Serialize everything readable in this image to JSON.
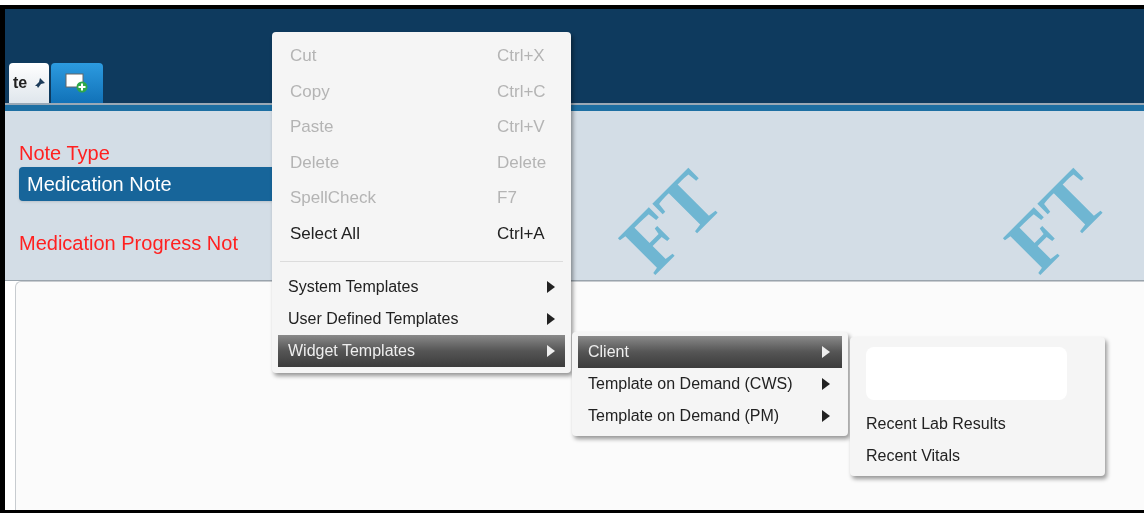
{
  "tabs": [
    {
      "label": "te",
      "kind": "note",
      "selected": true
    },
    {
      "kind": "new",
      "selected": false
    }
  ],
  "form": {
    "note_type_label": "Note Type",
    "note_type_value": "Medication Note",
    "progress_label": "Medication Progress Not"
  },
  "watermark": [
    "FT",
    "FT"
  ],
  "context_menu": {
    "items": [
      {
        "kind": "command",
        "label": "Cut",
        "shortcut": "Ctrl+X",
        "disabled": true
      },
      {
        "kind": "command",
        "label": "Copy",
        "shortcut": "Ctrl+C",
        "disabled": true
      },
      {
        "kind": "command",
        "label": "Paste",
        "shortcut": "Ctrl+V",
        "disabled": true
      },
      {
        "kind": "command",
        "label": "Delete",
        "shortcut": "Delete",
        "disabled": true
      },
      {
        "kind": "command",
        "label": "SpellCheck",
        "shortcut": "F7",
        "disabled": true
      },
      {
        "kind": "command",
        "label": "Select All",
        "shortcut": "Ctrl+A",
        "disabled": false
      },
      {
        "kind": "separator"
      },
      {
        "kind": "submenu",
        "label": "System Templates",
        "selected": false
      },
      {
        "kind": "submenu",
        "label": "User Defined Templates",
        "selected": false
      },
      {
        "kind": "submenu",
        "label": "Widget Templates",
        "selected": true
      }
    ]
  },
  "widget_submenu": {
    "items": [
      {
        "label": "Client",
        "selected": true
      },
      {
        "label": "Template on Demand (CWS)",
        "selected": false
      },
      {
        "label": "Template on Demand (PM)",
        "selected": false
      }
    ]
  },
  "client_submenu": {
    "items": [
      {
        "kind": "field"
      },
      {
        "kind": "item",
        "label": "Recent Lab Results"
      },
      {
        "kind": "item",
        "label": "Recent Vitals"
      }
    ]
  }
}
